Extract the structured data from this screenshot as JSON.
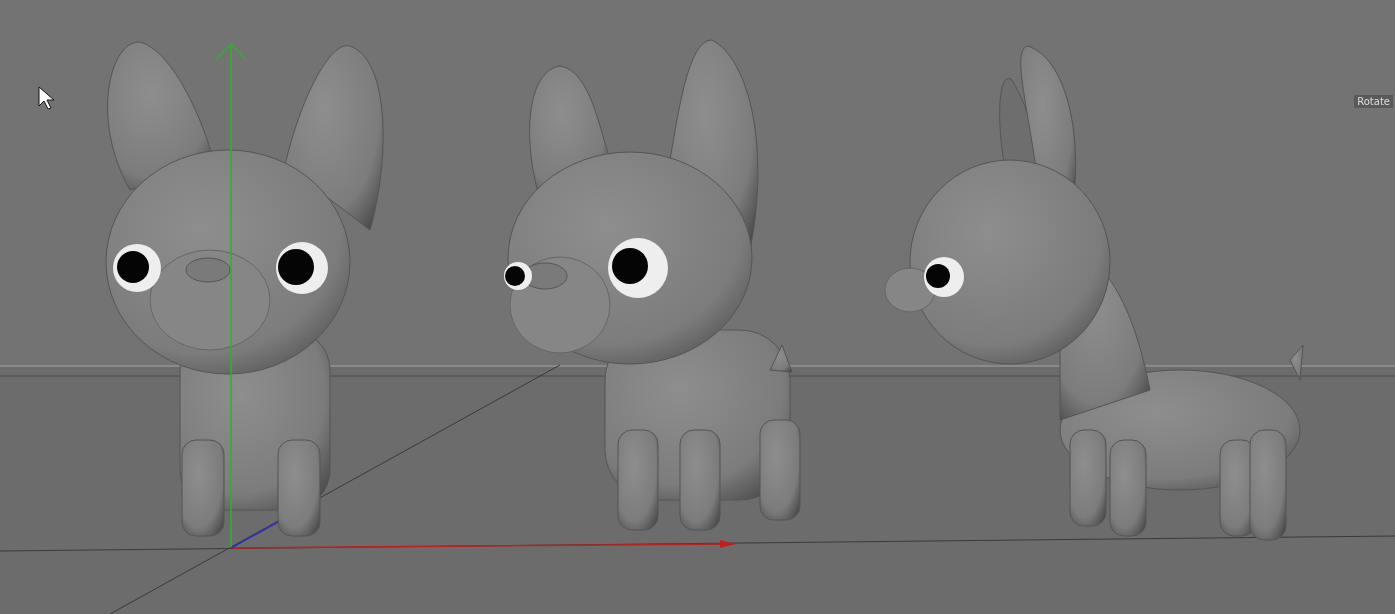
{
  "viewport": {
    "tooltip": "Rotate"
  }
}
